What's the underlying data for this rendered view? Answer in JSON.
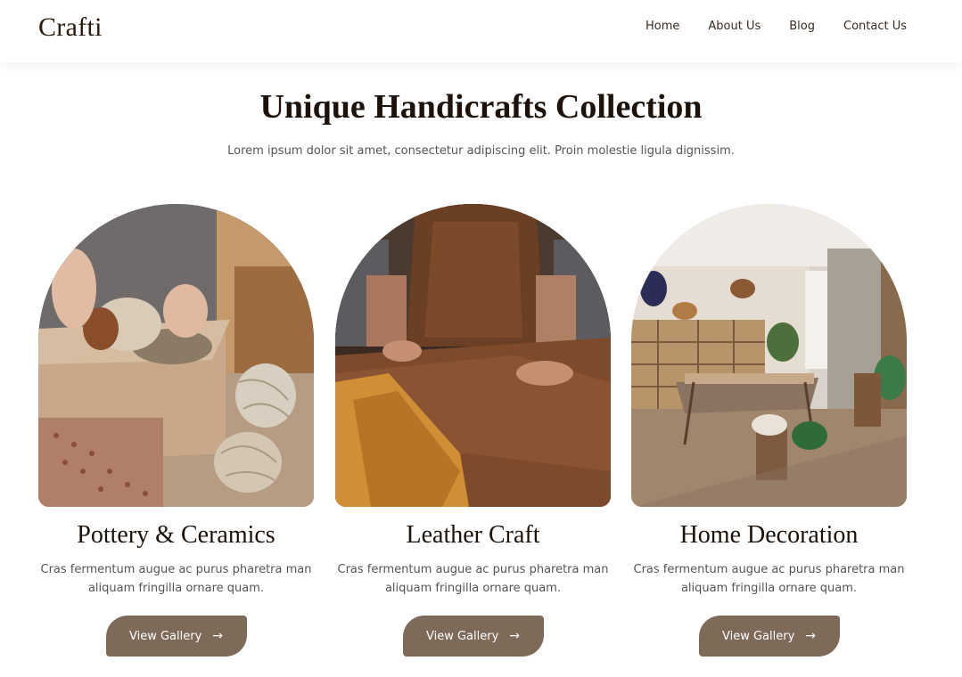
{
  "header": {
    "logo": "Crafti",
    "nav": [
      "Home",
      "About Us",
      "Blog",
      "Contact Us"
    ]
  },
  "hero": {
    "title": "Unique Handicrafts Collection",
    "subtitle": "Lorem ipsum dolor sit amet, consectetur adipiscing elit. Proin molestie ligula dignissim."
  },
  "cards": [
    {
      "title": "Pottery & Ceramics",
      "text": "Cras fermentum augue ac purus pharetra man aliquam fringilla ornare quam.",
      "button": "View Gallery",
      "arrow": "→"
    },
    {
      "title": "Leather Craft",
      "text": "Cras fermentum augue ac purus pharetra man aliquam fringilla ornare quam.",
      "button": "View Gallery",
      "arrow": "→"
    },
    {
      "title": "Home Decoration",
      "text": "Cras fermentum augue ac purus pharetra man aliquam fringilla ornare quam.",
      "button": "View Gallery",
      "arrow": "→"
    }
  ],
  "colors": {
    "button_bg": "#7d6a59",
    "heading": "#1c120a",
    "body_text": "#555555"
  },
  "icons": {
    "button_arrow": "arrow-right-icon"
  }
}
